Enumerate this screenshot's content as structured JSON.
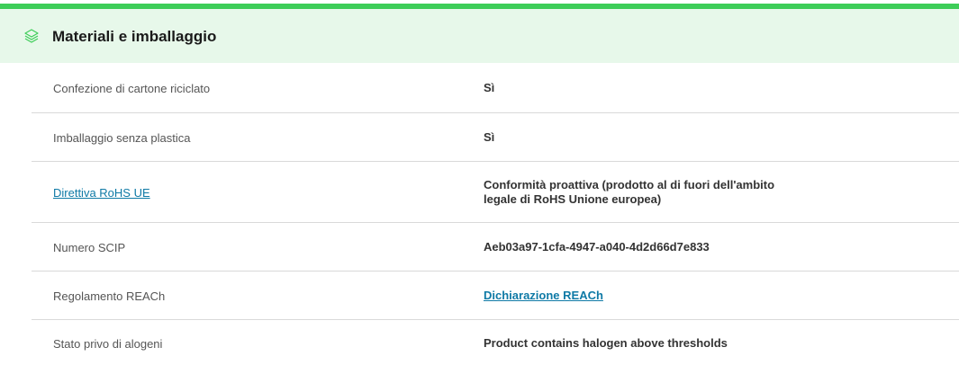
{
  "header": {
    "title": "Materiali e imballaggio",
    "icon": "layers-icon",
    "accent_color": "#3dcd58",
    "background_color": "#e7f8ea"
  },
  "rows": [
    {
      "label": "Confezione di cartone riciclato",
      "value": "Sì"
    },
    {
      "label": "Imballaggio senza plastica",
      "value": "Sì"
    },
    {
      "label": "Direttiva RoHS UE",
      "label_is_link": true,
      "value_line1": "Conformità proattiva (prodotto al di fuori dell'ambito",
      "value_line2": "legale di RoHS Unione europea)"
    },
    {
      "label": "Numero SCIP",
      "value": "Aeb03a97-1cfa-4947-a040-4d2d66d7e833"
    },
    {
      "label": "Regolamento REACh",
      "value": "Dichiarazione REACh",
      "value_is_link": true
    },
    {
      "label": "Stato privo di alogeni",
      "value": "Product contains halogen above thresholds"
    }
  ],
  "link_color": "#0f7aa6"
}
